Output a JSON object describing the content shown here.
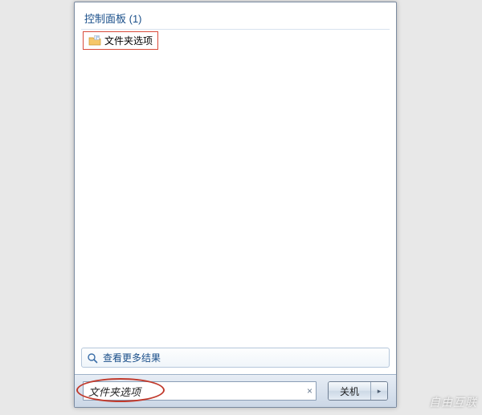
{
  "category": {
    "label": "控制面板 (1)"
  },
  "results": {
    "item0": {
      "label": "文件夹选项"
    }
  },
  "see_more": {
    "label": "查看更多结果"
  },
  "search": {
    "value": "文件夹选项",
    "clear": "×"
  },
  "shutdown": {
    "label": "关机",
    "arrow": "▸"
  },
  "watermark": "自由互联"
}
